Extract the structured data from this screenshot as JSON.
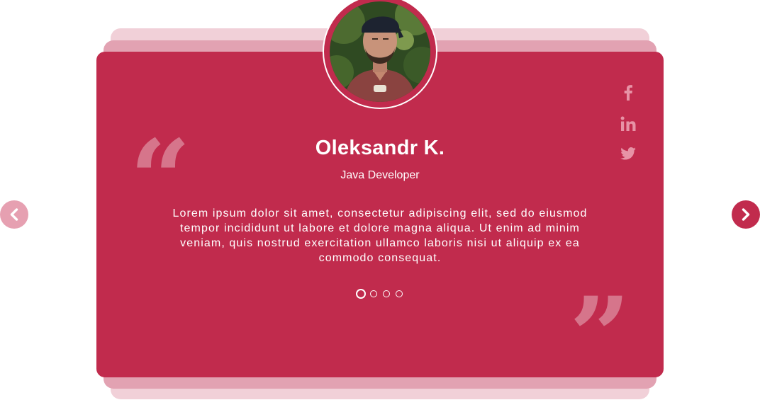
{
  "testimonial": {
    "name": "Oleksandr K.",
    "role": "Java Developer",
    "quote_text": "Lorem ipsum dolor sit amet, consectetur adipiscing elit, sed do eiusmod tempor incididunt ut labore et dolore magna aliqua. Ut enim ad minim veniam, quis nostrud exercitation ullamco laboris nisi ut aliquip ex ea commodo consequat.",
    "open_quote_glyph": "“",
    "close_quote_glyph": "”"
  },
  "pagination": {
    "total": 4,
    "active_index": 0
  },
  "social": [
    "facebook-icon",
    "linkedin-icon",
    "twitter-icon"
  ],
  "navigation": {
    "prev_icon": "chevron-left-icon",
    "next_icon": "chevron-right-icon"
  },
  "colors": {
    "card": "#c12b4d",
    "stack_mid": "#e2a2b2",
    "stack_back": "#f1d0d8",
    "prev_button": "#e6a0b1",
    "next_button": "#c12b4d",
    "social_icon": "#e793a6"
  }
}
